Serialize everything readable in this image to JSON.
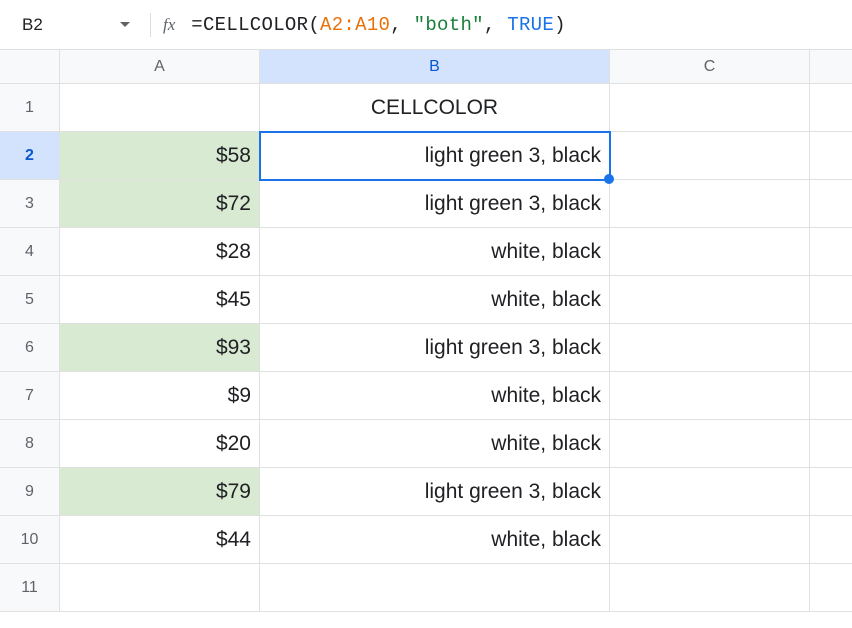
{
  "nameBox": "B2",
  "fxLabel": "fx",
  "formula": {
    "equals": "=",
    "fn": "CELLCOLOR",
    "open": "(",
    "range": "A2:A10",
    "comma1": ", ",
    "string": "\"both\"",
    "comma2": ", ",
    "bool": "TRUE",
    "close": ")"
  },
  "columns": [
    "A",
    "B",
    "C"
  ],
  "activeColumn": "B",
  "activeRow": 2,
  "rows": [
    {
      "num": 1,
      "a": "",
      "aGreen": false,
      "b": "CELLCOLOR",
      "bAlign": "center"
    },
    {
      "num": 2,
      "a": "$58",
      "aGreen": true,
      "b": "light green 3, black",
      "bAlign": "right",
      "active": true
    },
    {
      "num": 3,
      "a": "$72",
      "aGreen": true,
      "b": "light green 3, black",
      "bAlign": "right"
    },
    {
      "num": 4,
      "a": "$28",
      "aGreen": false,
      "b": "white, black",
      "bAlign": "right"
    },
    {
      "num": 5,
      "a": "$45",
      "aGreen": false,
      "b": "white, black",
      "bAlign": "right"
    },
    {
      "num": 6,
      "a": "$93",
      "aGreen": true,
      "b": "light green 3, black",
      "bAlign": "right"
    },
    {
      "num": 7,
      "a": "$9",
      "aGreen": false,
      "b": "white, black",
      "bAlign": "right"
    },
    {
      "num": 8,
      "a": "$20",
      "aGreen": false,
      "b": "white, black",
      "bAlign": "right"
    },
    {
      "num": 9,
      "a": "$79",
      "aGreen": true,
      "b": "light green 3, black",
      "bAlign": "right"
    },
    {
      "num": 10,
      "a": "$44",
      "aGreen": false,
      "b": "white, black",
      "bAlign": "right"
    },
    {
      "num": 11,
      "a": "",
      "aGreen": false,
      "b": "",
      "bAlign": "right"
    }
  ]
}
